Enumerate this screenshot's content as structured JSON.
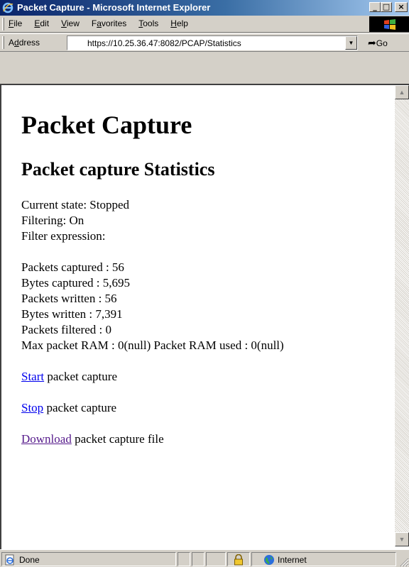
{
  "window": {
    "title": "Packet Capture - Microsoft Internet Explorer",
    "minimize_label": "_",
    "maximize_label": "□",
    "close_label": "×"
  },
  "menu": {
    "items": [
      {
        "underline": "F",
        "rest": "ile"
      },
      {
        "underline": "E",
        "rest": "dit"
      },
      {
        "underline": "V",
        "rest": "iew"
      },
      {
        "prefix": "F",
        "underline": "a",
        "rest": "vorites"
      },
      {
        "underline": "T",
        "rest": "ools"
      },
      {
        "underline": "H",
        "rest": "elp"
      }
    ]
  },
  "address": {
    "label_prefix": "A",
    "label_underline": "d",
    "label_rest": "dress",
    "url": "https://10.25.36.47:8082/PCAP/Statistics",
    "go_label": "Go"
  },
  "page": {
    "title": "Packet Capture",
    "subtitle": "Packet capture Statistics",
    "state": "Current state: Stopped",
    "filtering": "Filtering: On",
    "filter_expression": "Filter expression:",
    "packets_captured": "Packets captured : 56",
    "bytes_captured": "Bytes captured : 5,695",
    "packets_written": "Packets written : 56",
    "bytes_written": "Bytes written : 7,391",
    "packets_filtered": "Packets filtered : 0",
    "ram": "Max packet RAM : 0(null) Packet RAM used : 0(null)",
    "start_link": "Start",
    "start_rest": " packet capture",
    "stop_link": "Stop",
    "stop_rest": " packet capture",
    "download_link": "Download",
    "download_rest": " packet capture file"
  },
  "status": {
    "text": "Done",
    "zone": "Internet"
  }
}
